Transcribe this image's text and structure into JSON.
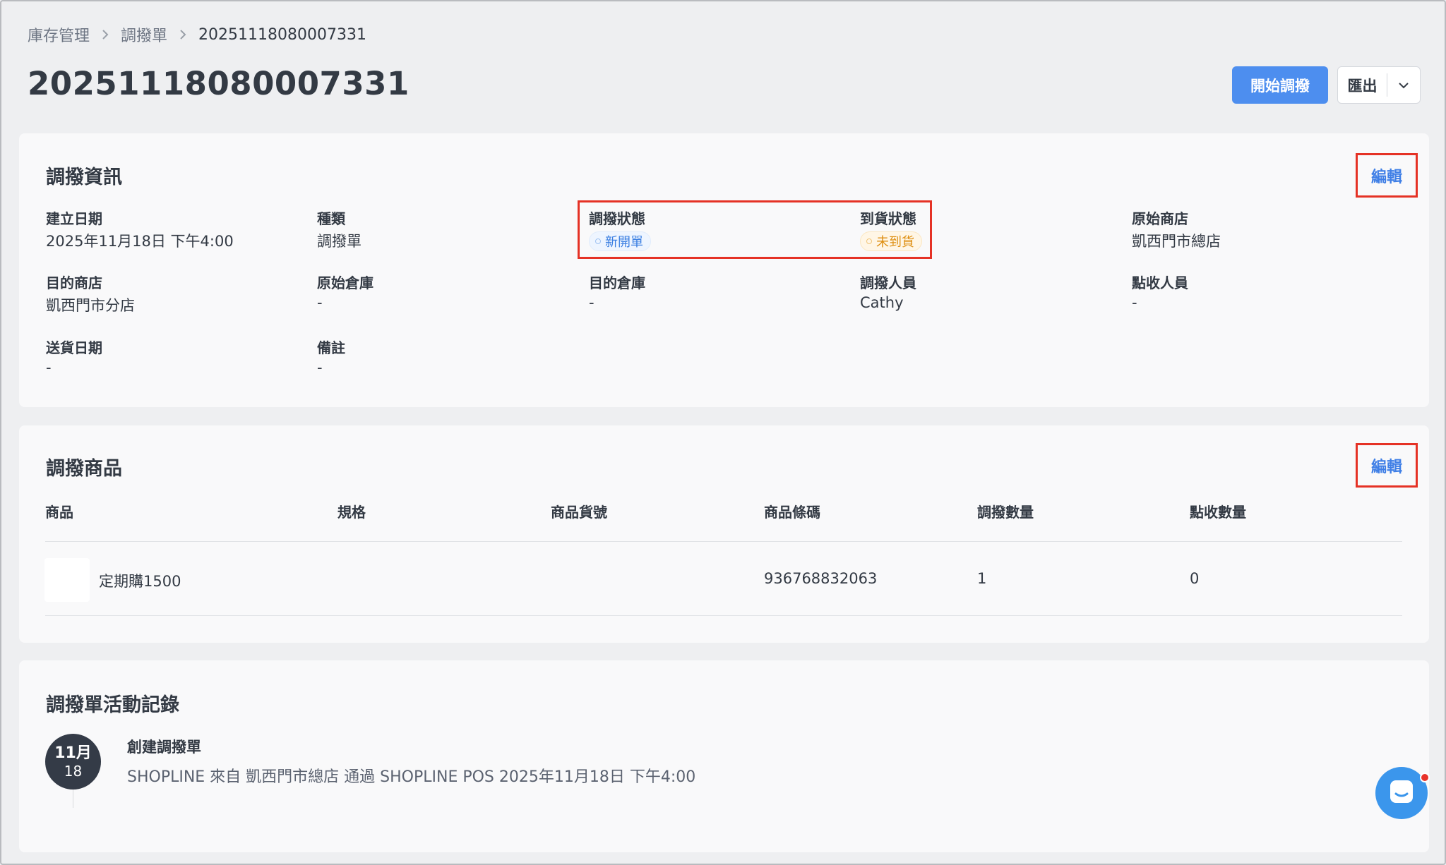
{
  "breadcrumb": {
    "items": [
      "庫存管理",
      "調撥單"
    ],
    "current": "20251118080007331"
  },
  "header": {
    "title": "20251118080007331",
    "primary_button": "開始調撥",
    "export_button": "匯出"
  },
  "transfer_info": {
    "title": "調撥資訊",
    "edit_label": "編輯",
    "fields": {
      "created_date": {
        "label": "建立日期",
        "value": "2025年11月18日 下午4:00"
      },
      "type": {
        "label": "種類",
        "value": "調撥單"
      },
      "transfer_status": {
        "label": "調撥狀態",
        "value": "新開單"
      },
      "arrival_status": {
        "label": "到貨狀態",
        "value": "未到貨"
      },
      "origin_store": {
        "label": "原始商店",
        "value": "凱西門市總店"
      },
      "dest_store": {
        "label": "目的商店",
        "value": "凱西門市分店"
      },
      "origin_warehouse": {
        "label": "原始倉庫",
        "value": "-"
      },
      "dest_warehouse": {
        "label": "目的倉庫",
        "value": "-"
      },
      "transfer_staff": {
        "label": "調撥人員",
        "value": "Cathy"
      },
      "receive_staff": {
        "label": "點收人員",
        "value": "-"
      },
      "delivery_date": {
        "label": "送貨日期",
        "value": "-"
      },
      "note": {
        "label": "備註",
        "value": "-"
      }
    }
  },
  "transfer_products": {
    "title": "調撥商品",
    "edit_label": "編輯",
    "columns": [
      "商品",
      "規格",
      "商品貨號",
      "商品條碼",
      "調撥數量",
      "點收數量"
    ],
    "rows": [
      {
        "product": "定期購1500",
        "spec": "",
        "sku": "",
        "barcode": "936768832063",
        "transfer_qty": "1",
        "received_qty": "0"
      }
    ]
  },
  "activity_log": {
    "title": "調撥單活動記錄",
    "entries": [
      {
        "month": "11月",
        "day": "18",
        "title": "創建調撥單",
        "description": "SHOPLINE 來自 凱西門市總店 通過 SHOPLINE POS 2025年11月18日 下午4:00"
      }
    ]
  },
  "colors": {
    "primary": "#4d8eef",
    "highlight_border": "#e53225",
    "badge_new": "#3b7fe2",
    "badge_pending": "#de8f12",
    "chat": "#3b96ec"
  },
  "icons": {
    "breadcrumb_separator": "chevron-right-icon",
    "export_caret": "chevron-down-icon",
    "chat": "chat-icon"
  }
}
